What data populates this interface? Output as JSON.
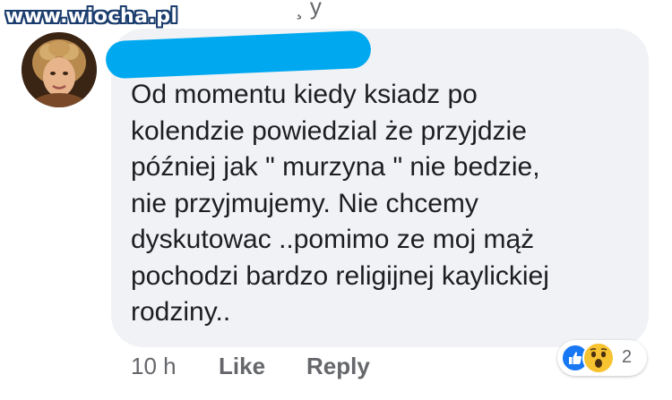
{
  "watermark": "www.wiocha.pl",
  "comment": {
    "lines": [
      "Od momentu kiedy ksiadz po",
      "kolendzie powiedzial że przyjdzie",
      "później jak \" murzyna \" nie bedzie,",
      "nie przyjmujemy. Nie chcemy",
      "dyskutowac ..pomimo ze moj mąż",
      "pochodzi bardzo religijnej kaylickiej",
      "rodziny.."
    ]
  },
  "actions": {
    "time": "10 h",
    "like": "Like",
    "reply": "Reply"
  },
  "reactions": {
    "icons": [
      "like-icon",
      "wow-icon"
    ],
    "count": "2"
  },
  "colors": {
    "bubble": "#f0f2f5",
    "name_redaction": "#00a8f0",
    "like_blue": "#1877f2",
    "wow_yellow": "#f7c331"
  }
}
